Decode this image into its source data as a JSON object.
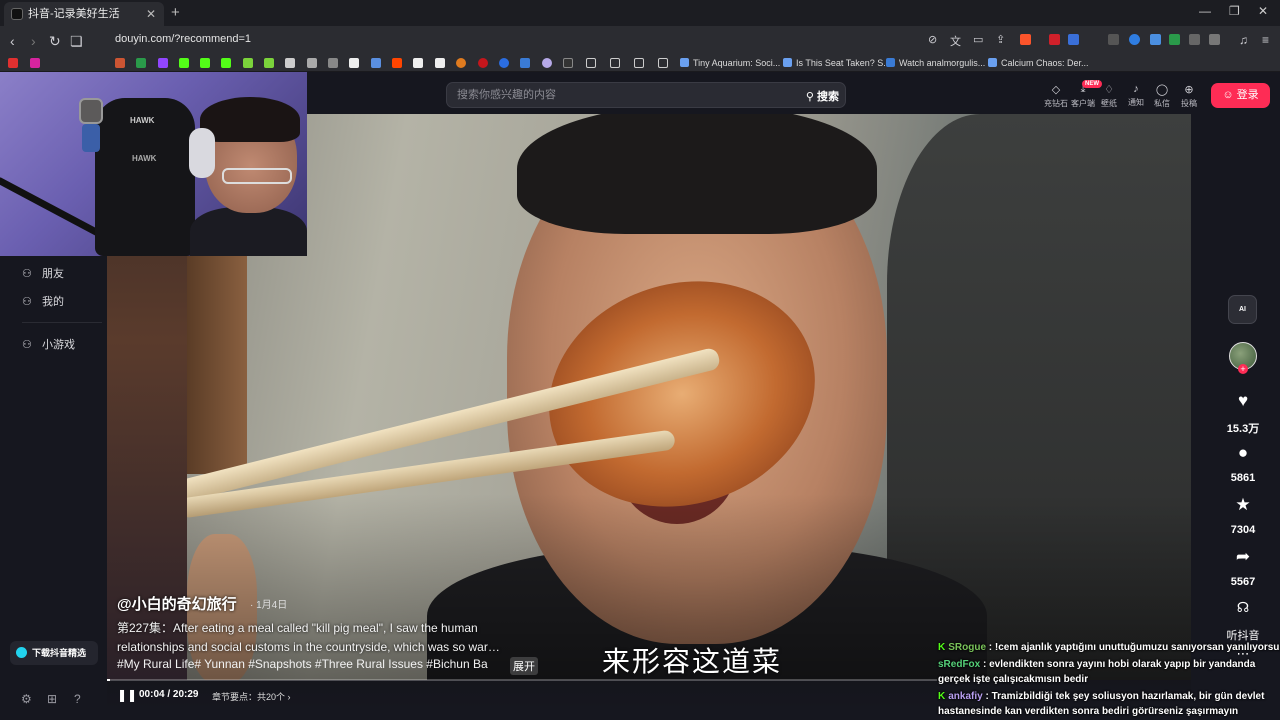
{
  "browser": {
    "tab_title": "抖音-记录美好生活",
    "url": "douyin.com/?recommend=1",
    "bookmarks": [
      "Tiny Aquarium: Soci...",
      "Is This Seat Taken? S...",
      "Watch analmorgulis...",
      "Calcium Chaos: Der..."
    ]
  },
  "douyin": {
    "search_placeholder": "搜索你感兴趣的内容",
    "search_button": "搜索",
    "top_actions": [
      "充钻石",
      "客户端",
      "壁纸",
      "通知",
      "私信",
      "投稿"
    ],
    "new_badge": "NEW",
    "login_button": "登录",
    "sidebar": [
      {
        "label": "朋友",
        "icon": "friends-icon"
      },
      {
        "label": "我的",
        "icon": "profile-icon"
      },
      {
        "label": "小游戏",
        "icon": "game-icon"
      }
    ],
    "download_pill": "下载抖音精选"
  },
  "video": {
    "author": "@小白的奇幻旅行",
    "date": "· 1月4日",
    "description": "第227集：After eating a meal called \"kill pig meal\", I saw the human relationships and social customs in the countryside, which was so war…",
    "tags": "#My Rural Life# Yunnan #Snapshots #Three Rural Issues #Bichun Ba",
    "expand": "展开",
    "subtitle": "来形容这道菜",
    "time": "00:04 / 20:29",
    "chapter": "章节要点：共20个",
    "progress_fraction": 0.0033,
    "ai_button": "AI",
    "likes": "15.3万",
    "comments": "5861",
    "favorites": "7304",
    "shares": "5567",
    "listen": "听抖音"
  },
  "stream": {
    "chair_brand": "HAWK",
    "chat": [
      {
        "user": "SRogue",
        "text": "!cem ajanlık yaptığını unuttuğumuzu sanıyorsan yanılıyorsun abi"
      },
      {
        "user": "sRedFox",
        "text": "evlendikten sonra yayını hobi olarak yapıp bir yandanda gerçek işte çalışıcakmısın bedir"
      },
      {
        "user": "ankafiy",
        "text": "Tramizbildiği tek şey soliusyon hazırlamak, bir gün devlet hastanesinde kan verdikten sonra bediri görürseniz şaşırmayın"
      }
    ]
  },
  "colors": {
    "accent": "#fe2c55",
    "background": "#16171f",
    "kick_green": "#53fc18"
  }
}
